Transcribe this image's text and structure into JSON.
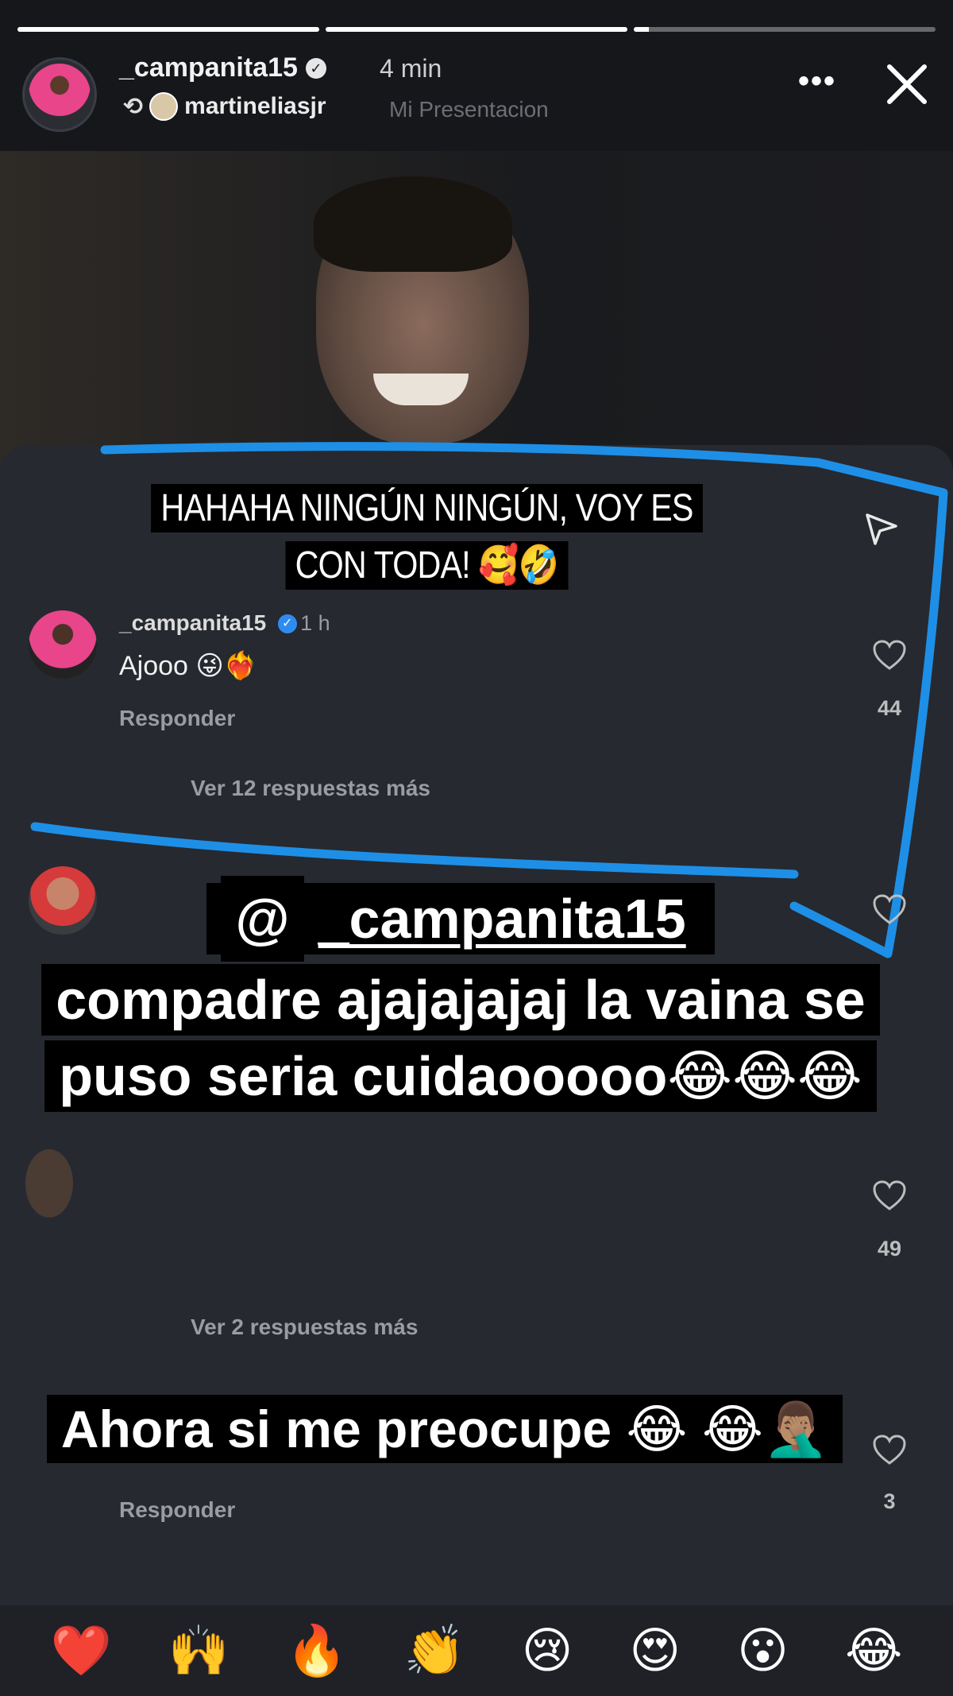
{
  "progress": [
    1.0,
    1.0,
    0.05
  ],
  "header": {
    "username": "_campanita15",
    "time": "4 min",
    "repost_user": "martineliasjr",
    "faded_text": "Mi Presentacion"
  },
  "caption_top": "HAHAHA NINGÚN NINGÚN, VOY ES CON TODA! 🥰🤣",
  "comment1": {
    "user": "_campanita15",
    "time": "1 h",
    "text": "Ajooo 😜❤️‍🔥",
    "reply": "Responder",
    "likes": "44"
  },
  "more_replies_1": "Ver 12 respuestas más",
  "threads_handle": "_campanita15",
  "caption_main": "compadre ajajajajaj la vaina se puso seria cuidaooooo😂😂😂",
  "likes_2": "49",
  "more_replies_2": "Ver 2 respuestas más",
  "caption_bottom": "Ahora si me preocupe 😂 😂🤦🏽‍♂️",
  "likes_3": "3",
  "reply_3": "Responder",
  "reactions": [
    "❤️",
    "🙌",
    "🔥",
    "👏",
    "😢",
    "😍",
    "😮",
    "😂"
  ],
  "colors": {
    "highlight": "#1e8fe6",
    "background": "#262930"
  }
}
